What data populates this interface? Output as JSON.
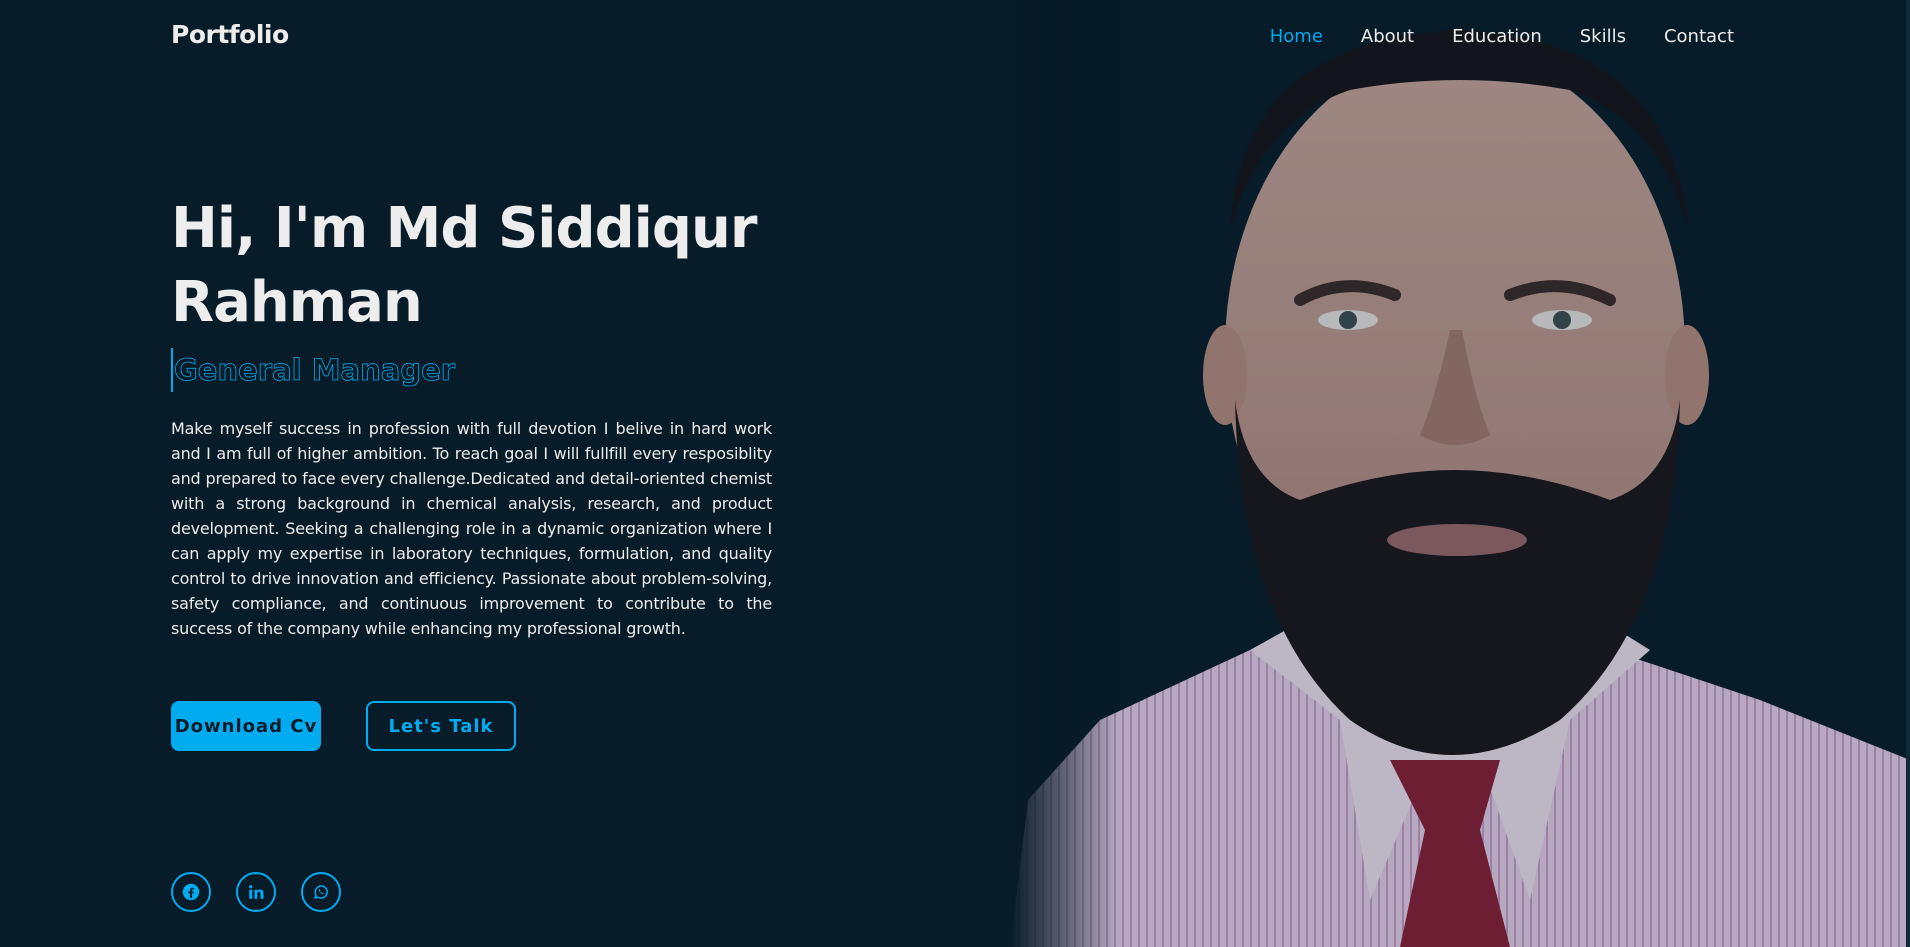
{
  "header": {
    "logo": "Portfolio",
    "nav": [
      {
        "label": "Home",
        "active": true
      },
      {
        "label": "About",
        "active": false
      },
      {
        "label": "Education",
        "active": false
      },
      {
        "label": "Skills",
        "active": false
      },
      {
        "label": "Contact",
        "active": false
      }
    ]
  },
  "hero": {
    "greeting_line1": "Hi, I'm Md Siddiqur",
    "greeting_line2": "Rahman",
    "role": "General Manager",
    "description": "Make myself success in profession with full devotion I belive in hard work and I am full of higher ambition. To reach goal I will fullfill every resposiblity and prepared to face every challenge.Dedicated and detail-oriented chemist with a strong background in chemical analysis, research, and product development. Seeking a challenging role in a dynamic organization where I can apply my expertise in laboratory techniques, formulation, and quality control to drive innovation and efficiency. Passionate about problem-solving, safety compliance, and continuous improvement to contribute to the success of the company while enhancing my professional growth.",
    "buttons": {
      "download": "Download Cv",
      "talk": "Let's Talk"
    }
  },
  "social": [
    {
      "icon": "facebook-icon"
    },
    {
      "icon": "linkedin-icon"
    },
    {
      "icon": "whatsapp-icon"
    }
  ],
  "colors": {
    "background": "#081b29",
    "accent": "#00abf0",
    "text": "#ededed"
  }
}
